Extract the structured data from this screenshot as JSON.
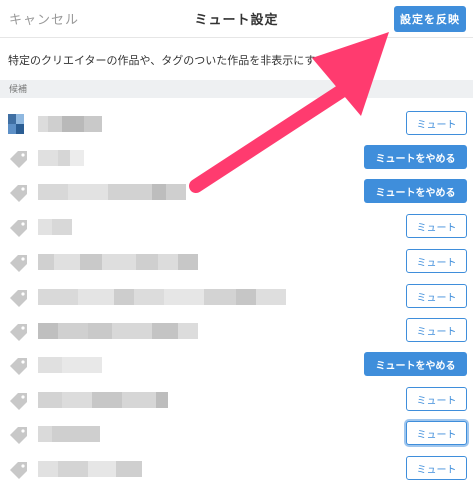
{
  "header": {
    "cancel_label": "キャンセル",
    "title": "ミュート設定",
    "apply_label": "設定を反映"
  },
  "description": "特定のクリエイターの作品や、タグのついた作品を非表示にする",
  "section": {
    "label": "候補"
  },
  "rows": [
    {
      "kind": "user",
      "button": "mute",
      "label": "ミュート"
    },
    {
      "kind": "tag",
      "button": "unmute",
      "label": "ミュートをやめる"
    },
    {
      "kind": "tag",
      "button": "unmute",
      "label": "ミュートをやめる"
    },
    {
      "kind": "tag",
      "button": "mute",
      "label": "ミュート"
    },
    {
      "kind": "tag",
      "button": "mute",
      "label": "ミュート"
    },
    {
      "kind": "tag",
      "button": "mute",
      "label": "ミュート"
    },
    {
      "kind": "tag",
      "button": "mute",
      "label": "ミュート"
    },
    {
      "kind": "tag",
      "button": "unmute",
      "label": "ミュートをやめる"
    },
    {
      "kind": "tag",
      "button": "mute",
      "label": "ミュート"
    },
    {
      "kind": "tag",
      "button": "mute",
      "label": "ミュート"
    },
    {
      "kind": "tag",
      "button": "mute",
      "label": "ミュート"
    }
  ],
  "colors": {
    "accent": "#3f8edb",
    "annotation_arrow": "#ff3b6f",
    "tag_icon": "#c8c8c8"
  },
  "icons": {
    "user": "user-avatar-icon",
    "tag": "tag-icon",
    "annotation": "pointer-arrow-icon"
  }
}
